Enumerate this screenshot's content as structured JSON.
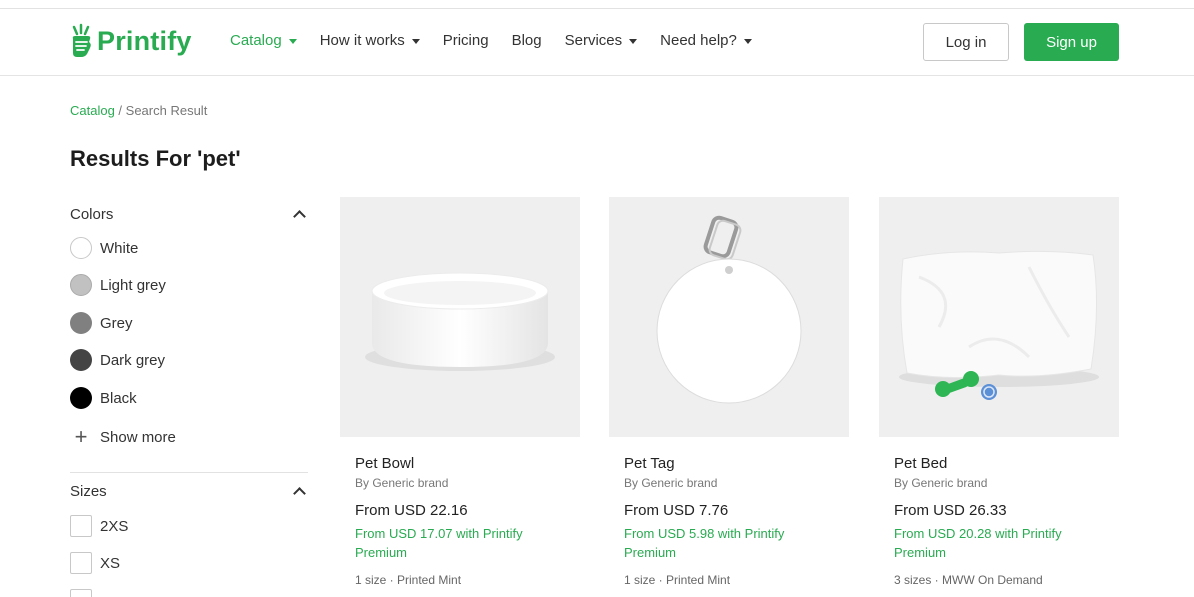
{
  "header": {
    "logo_text": "Printify",
    "nav": [
      {
        "label": "Catalog",
        "dropdown": true,
        "active": true
      },
      {
        "label": "How it works",
        "dropdown": true,
        "active": false
      },
      {
        "label": "Pricing",
        "dropdown": false,
        "active": false
      },
      {
        "label": "Blog",
        "dropdown": false,
        "active": false
      },
      {
        "label": "Services",
        "dropdown": true,
        "active": false
      },
      {
        "label": "Need help?",
        "dropdown": true,
        "active": false
      }
    ],
    "login_label": "Log in",
    "signup_label": "Sign up"
  },
  "breadcrumb": {
    "link": "Catalog",
    "separator": " / ",
    "current": "Search Result"
  },
  "page_title": "Results For 'pet'",
  "filters": {
    "colors": {
      "title": "Colors",
      "items": [
        {
          "label": "White",
          "color": "#ffffff"
        },
        {
          "label": "Light grey",
          "color": "#c1c1c1"
        },
        {
          "label": "Grey",
          "color": "#808080"
        },
        {
          "label": "Dark grey",
          "color": "#444444"
        },
        {
          "label": "Black",
          "color": "#000000"
        }
      ],
      "show_more": "Show more"
    },
    "sizes": {
      "title": "Sizes",
      "items": [
        {
          "label": "2XS"
        },
        {
          "label": "XS"
        }
      ]
    }
  },
  "products": [
    {
      "name": "Pet Bowl",
      "brand": "By Generic brand",
      "price": "From USD 22.16",
      "premium": "From USD 17.07 with Printify Premium",
      "meta": "1 size · Printed Mint",
      "image": "pet-bowl"
    },
    {
      "name": "Pet Tag",
      "brand": "By Generic brand",
      "price": "From USD 7.76",
      "premium": "From USD 5.98 with Printify Premium",
      "meta": "1 size · Printed Mint",
      "image": "pet-tag"
    },
    {
      "name": "Pet Bed",
      "brand": "By Generic brand",
      "price": "From USD 26.33",
      "premium": "From USD 20.28 with Printify Premium",
      "meta": "3 sizes · MWW On Demand",
      "image": "pet-bed"
    }
  ],
  "colors": {
    "brand_green": "#29ab51"
  }
}
